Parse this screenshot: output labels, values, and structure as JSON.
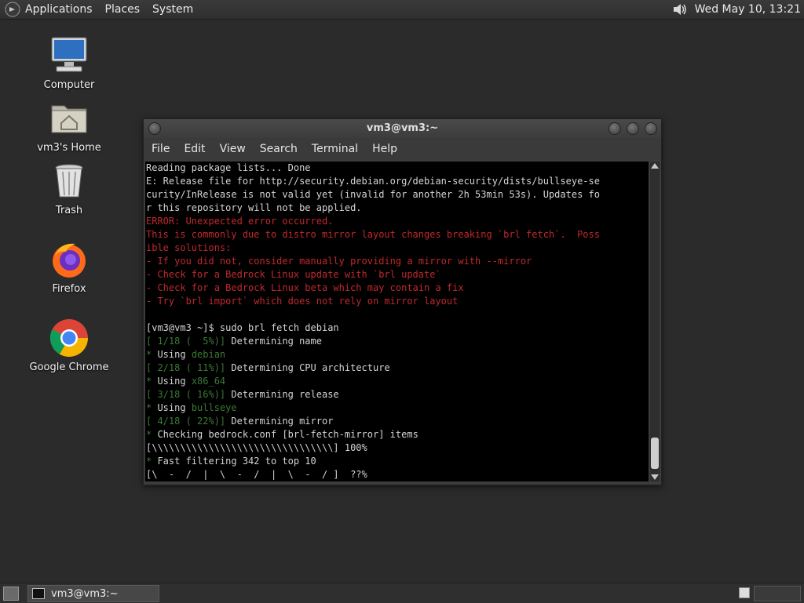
{
  "top_panel": {
    "menus": [
      "Applications",
      "Places",
      "System"
    ],
    "clock": "Wed May 10, 13:21",
    "volume_icon": "volume-icon"
  },
  "desktop": {
    "icons": [
      {
        "label": "Computer",
        "icon": "computer-icon"
      },
      {
        "label": "vm3's Home",
        "icon": "home-folder-icon"
      },
      {
        "label": "Trash",
        "icon": "trash-icon"
      },
      {
        "label": "Firefox",
        "icon": "firefox-icon"
      },
      {
        "label": "Google Chrome",
        "icon": "chrome-icon"
      }
    ]
  },
  "terminal": {
    "title": "vm3@vm3:~",
    "menu": [
      "File",
      "Edit",
      "View",
      "Search",
      "Terminal",
      "Help"
    ],
    "lines": [
      {
        "t": "Reading package lists... Done",
        "c": ""
      },
      {
        "t": "E: Release file for http://security.debian.org/debian-security/dists/bullseye-se",
        "c": ""
      },
      {
        "t": "curity/InRelease is not valid yet (invalid for another 2h 53min 53s). Updates fo",
        "c": ""
      },
      {
        "t": "r this repository will not be applied.",
        "c": ""
      },
      {
        "t": "ERROR: Unexpected error occurred.",
        "c": "red"
      },
      {
        "t": "This is commonly due to distro mirror layout changes breaking `brl fetch`.  Poss",
        "c": "red"
      },
      {
        "t": "ible solutions:",
        "c": "red"
      },
      {
        "t": "- If you did not, consider manually providing a mirror with --mirror",
        "c": "red"
      },
      {
        "t": "- Check for a Bedrock Linux update with `brl update`",
        "c": "red"
      },
      {
        "t": "- Check for a Bedrock Linux beta which may contain a fix",
        "c": "red"
      },
      {
        "t": "- Try `brl import` which does not rely on mirror layout",
        "c": "red"
      },
      {
        "t": "",
        "c": ""
      },
      {
        "t": "[vm3@vm3 ~]$ sudo brl fetch debian",
        "c": ""
      },
      {
        "parts": [
          {
            "t": "[ 1/18 (  5%)]",
            "c": "grn"
          },
          {
            "t": " Determining name",
            "c": ""
          }
        ]
      },
      {
        "parts": [
          {
            "t": "*",
            "c": "grn"
          },
          {
            "t": " Using ",
            "c": ""
          },
          {
            "t": "debian",
            "c": "grn"
          }
        ]
      },
      {
        "parts": [
          {
            "t": "[ 2/18 ( 11%)]",
            "c": "grn"
          },
          {
            "t": " Determining CPU architecture",
            "c": ""
          }
        ]
      },
      {
        "parts": [
          {
            "t": "*",
            "c": "grn"
          },
          {
            "t": " Using ",
            "c": ""
          },
          {
            "t": "x86_64",
            "c": "grn"
          }
        ]
      },
      {
        "parts": [
          {
            "t": "[ 3/18 ( 16%)]",
            "c": "grn"
          },
          {
            "t": " Determining release",
            "c": ""
          }
        ]
      },
      {
        "parts": [
          {
            "t": "*",
            "c": "grn"
          },
          {
            "t": " Using ",
            "c": ""
          },
          {
            "t": "bullseye",
            "c": "grn"
          }
        ]
      },
      {
        "parts": [
          {
            "t": "[ 4/18 ( 22%)]",
            "c": "grn"
          },
          {
            "t": " Determining mirror",
            "c": ""
          }
        ]
      },
      {
        "parts": [
          {
            "t": "*",
            "c": "grn"
          },
          {
            "t": " Checking bedrock.conf [brl-fetch-mirror] items",
            "c": ""
          }
        ]
      },
      {
        "t": "[\\\\\\\\\\\\\\\\\\\\\\\\\\\\\\\\\\\\\\\\\\\\\\\\\\\\\\\\\\\\\\\\] 100%",
        "c": ""
      },
      {
        "parts": [
          {
            "t": "*",
            "c": "grn"
          },
          {
            "t": " Fast filtering 342 to top 10",
            "c": ""
          }
        ]
      },
      {
        "t": "[\\  -  /  |  \\  -  /  |  \\  -  / ]  ??%",
        "c": ""
      }
    ]
  },
  "taskbar": {
    "task_label": "vm3@vm3:~"
  },
  "colors": {
    "error_red": "#c0282d",
    "progress_green": "#3a7a34",
    "terminal_bg": "#000000"
  }
}
